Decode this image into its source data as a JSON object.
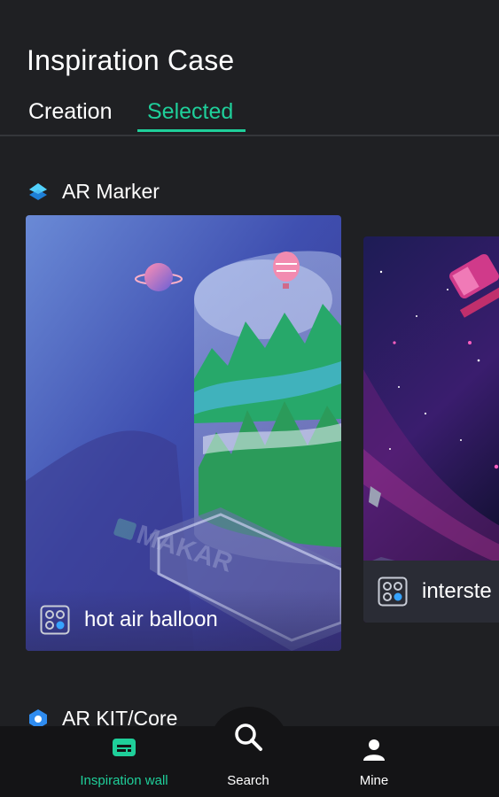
{
  "header": {
    "title": "Inspiration Case"
  },
  "tabs": [
    {
      "label": "Creation"
    },
    {
      "label": "Selected"
    }
  ],
  "sections": [
    {
      "title": "AR Marker",
      "cards": [
        {
          "title": "hot air balloon",
          "watermark": "MAKAR"
        },
        {
          "title": "interste"
        }
      ]
    },
    {
      "title": "AR KIT/Core"
    }
  ],
  "bottom_nav": [
    {
      "label": "Inspiration wall",
      "icon": "inspiration-wall-icon"
    },
    {
      "label": "Search",
      "icon": "search-icon"
    },
    {
      "label": "Mine",
      "icon": "person-icon"
    }
  ],
  "colors": {
    "accent": "#1fcf9a",
    "background": "#1f2023",
    "nav_background": "#141416"
  }
}
